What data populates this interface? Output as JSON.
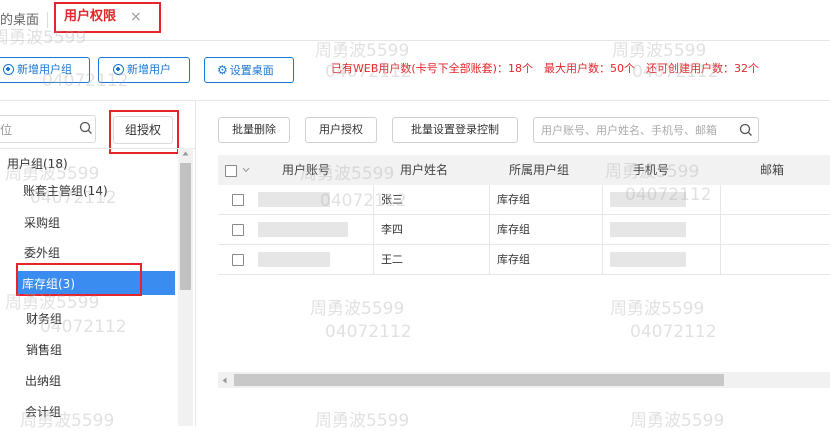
{
  "tabs": {
    "desk_label": "的桌面",
    "active_label": "用户权限",
    "close_glyph": "×"
  },
  "toolbar": {
    "add_group_label": "新增用户组",
    "add_user_label": "新增用户",
    "set_desk_label": "设置桌面",
    "info_text": "已有WEB用户数(卡号下全部账套)：18个　最大用户数：50个　还可创建用户数：32个"
  },
  "left": {
    "search_placeholder": "位",
    "group_auth_label": "组授权",
    "tree": {
      "root": "用户组(18)",
      "items": [
        "账套主管组(14)",
        "采购组",
        "委外组",
        "库存组(3)",
        "财务组",
        "销售组",
        "出纳组",
        "会计组"
      ]
    }
  },
  "right": {
    "buttons": {
      "batch_delete": "批量删除",
      "user_auth": "用户授权",
      "batch_login": "批量设置登录控制"
    },
    "search_placeholder": "用户账号、用户姓名、手机号、邮箱",
    "columns": [
      "用户账号",
      "用户姓名",
      "所属用户组",
      "手机号",
      "邮箱"
    ],
    "rows": [
      {
        "name": "张三",
        "group": "库存组"
      },
      {
        "name": "李四",
        "group": "库存组"
      },
      {
        "name": "王二",
        "group": "库存组"
      }
    ]
  },
  "watermark": {
    "name": "周勇波5599",
    "number": "04072112"
  },
  "colors": {
    "accent_blue": "#1976d2",
    "highlight_red": "#e5252a",
    "selected_bg": "#3a8cf0"
  }
}
